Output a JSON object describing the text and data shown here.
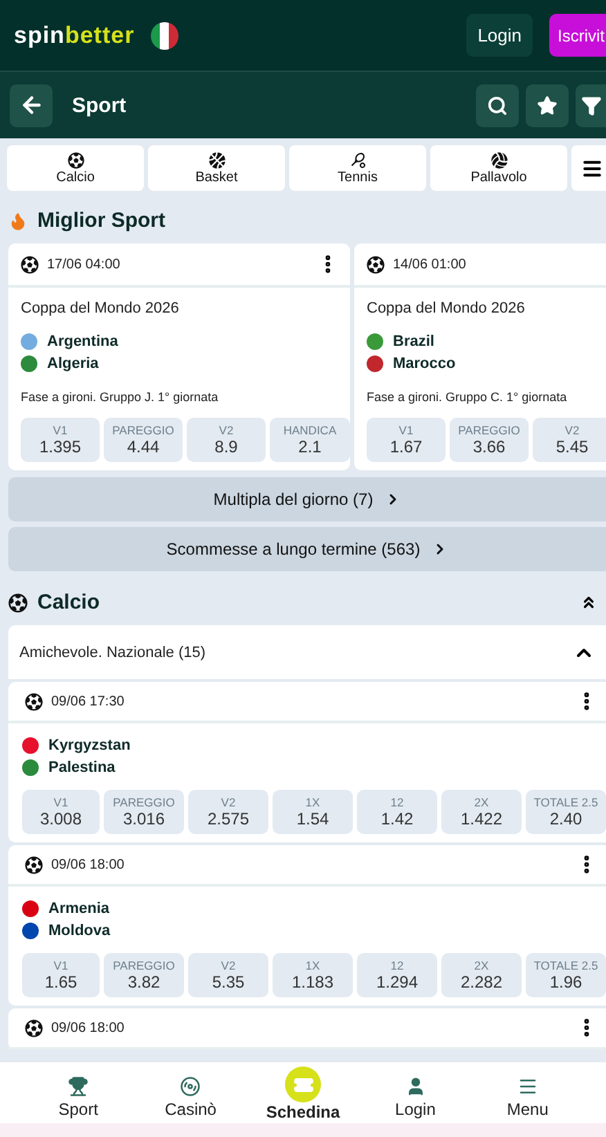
{
  "header": {
    "logo": {
      "first": "spin",
      "second": "better"
    },
    "login": "Login",
    "signup": "Iscrivit"
  },
  "subheader": {
    "title": "Sport"
  },
  "sport_tabs": [
    {
      "label": "Calcio",
      "kind": "soccer",
      "selected": false
    },
    {
      "label": "Basket",
      "kind": "basketball",
      "selected": false
    },
    {
      "label": "Tennis",
      "kind": "tennis",
      "selected": false
    },
    {
      "label": "Pallavolo",
      "kind": "volleyball",
      "selected": false
    }
  ],
  "top_section": {
    "title": "Miglior Sport",
    "cards": [
      {
        "time": "17/06 04:00",
        "competition": "Coppa del Mondo 2026",
        "teams": [
          {
            "name": "Argentina",
            "color": "#74acdf"
          },
          {
            "name": "Algeria",
            "color": "#2e8b3d"
          }
        ],
        "stage": "Fase a gironi. Gruppo J. 1° giornata",
        "odds": [
          {
            "label": "V1",
            "value": "1.395"
          },
          {
            "label": "PAREGGIO",
            "value": "4.44"
          },
          {
            "label": "V2",
            "value": "8.9"
          },
          {
            "label": "HANDICA",
            "value": "2.1"
          }
        ]
      },
      {
        "time": "14/06 01:00",
        "competition": "Coppa del Mondo 2026",
        "teams": [
          {
            "name": "Brazil",
            "color": "#3a9a3a"
          },
          {
            "name": "Marocco",
            "color": "#c1272d"
          }
        ],
        "stage": "Fase a gironi. Gruppo C. 1° giornata",
        "odds": [
          {
            "label": "V1",
            "value": "1.67"
          },
          {
            "label": "PAREGGIO",
            "value": "3.66"
          },
          {
            "label": "V2",
            "value": "5.45"
          }
        ]
      }
    ]
  },
  "links": [
    {
      "label": "Multipla del giorno (7)"
    },
    {
      "label": "Scommesse a lungo termine (563)"
    }
  ],
  "section": {
    "title": "Calcio",
    "league": "Amichevole. Nazionale (15)",
    "matches": [
      {
        "time": "09/06 17:30",
        "teams": [
          {
            "name": "Kyrgyzstan",
            "color": "#e8112d"
          },
          {
            "name": "Palestina",
            "color": "#2a8a3e"
          }
        ],
        "odds": [
          {
            "label": "V1",
            "value": "3.008"
          },
          {
            "label": "PAREGGIO",
            "value": "3.016"
          },
          {
            "label": "V2",
            "value": "2.575"
          },
          {
            "label": "1X",
            "value": "1.54"
          },
          {
            "label": "12",
            "value": "1.42"
          },
          {
            "label": "2X",
            "value": "1.422"
          },
          {
            "label": "TOTALE 2.5",
            "value": "2.40"
          }
        ]
      },
      {
        "time": "09/06 18:00",
        "teams": [
          {
            "name": "Armenia",
            "color": "#d90012"
          },
          {
            "name": "Moldova",
            "color": "#0046ae"
          }
        ],
        "odds": [
          {
            "label": "V1",
            "value": "1.65"
          },
          {
            "label": "PAREGGIO",
            "value": "3.82"
          },
          {
            "label": "V2",
            "value": "5.35"
          },
          {
            "label": "1X",
            "value": "1.183"
          },
          {
            "label": "12",
            "value": "1.294"
          },
          {
            "label": "2X",
            "value": "2.282"
          },
          {
            "label": "TOTALE 2.5",
            "value": "1.96"
          }
        ]
      },
      {
        "time": "09/06 18:00"
      }
    ]
  },
  "bottom_nav": [
    {
      "label": "Sport",
      "kind": "trophy",
      "selected": false
    },
    {
      "label": "Casinò",
      "kind": "chip",
      "selected": false
    },
    {
      "label": "Schedina",
      "kind": "ticket",
      "selected": true
    },
    {
      "label": "Login",
      "kind": "user",
      "selected": false
    },
    {
      "label": "Menu",
      "kind": "menu",
      "selected": false
    }
  ]
}
